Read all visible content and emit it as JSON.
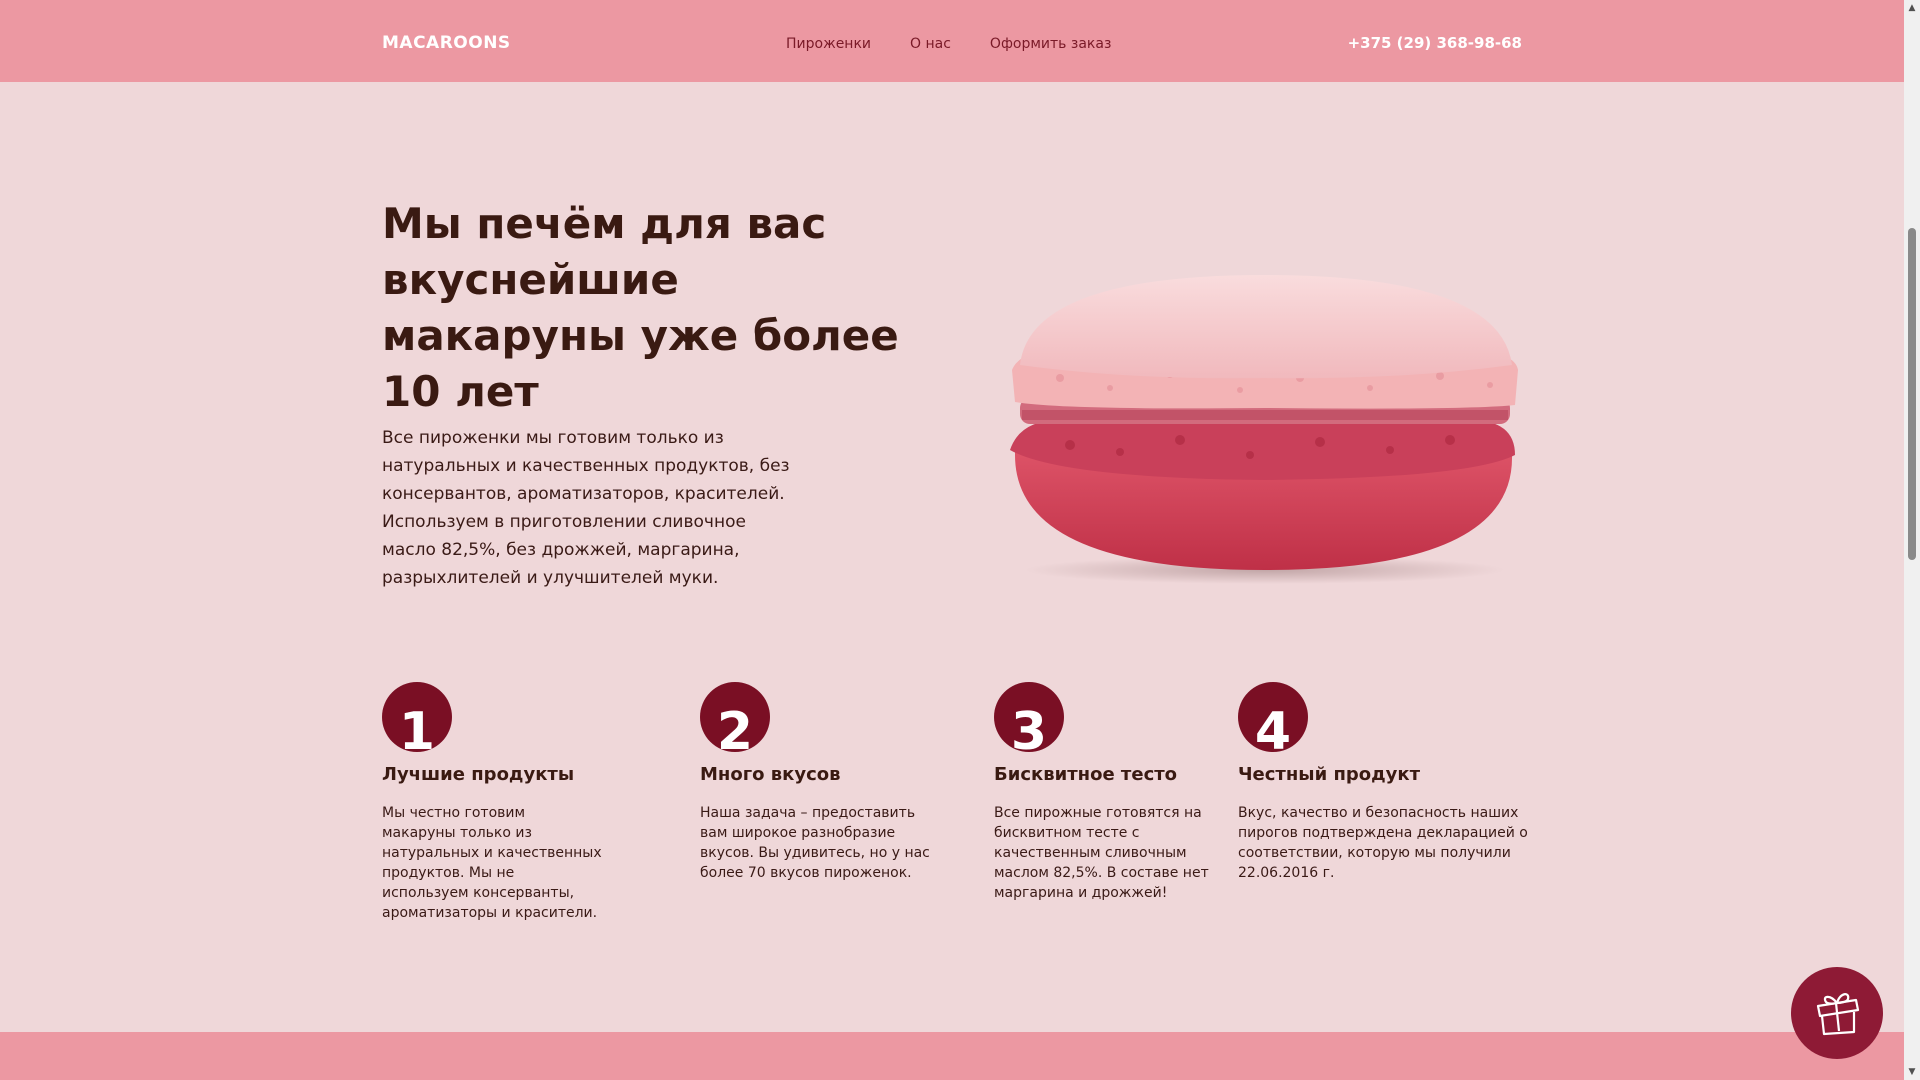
{
  "header": {
    "logo": "MACAROONS",
    "nav": [
      "Пироженки",
      "О нас",
      "Оформить заказ"
    ],
    "phone": "+375 (29) 368-98-68"
  },
  "hero": {
    "title": "Мы печём для вас вкуснейшие макаруны уже более 10 лет",
    "text": "Все пироженки мы готовим только из натуральных и качественных продуктов, без консервантов, ароматизаторов, красителей. Используем в приготовлении сливочное масло 82,5%, без дрожжей, маргарина, разрыхлителей и улучшителей муки."
  },
  "features": [
    {
      "number": "1",
      "title": "Лучшие продукты",
      "text": "Мы честно готовим макаруны только из натуральных и качественных продуктов. Мы не используем консерванты, ароматизаторы и красители."
    },
    {
      "number": "2",
      "title": "Много вкусов",
      "text": "Наша задача – предоставить вам широкое разнобразие вкусов. Вы удивитесь, но у нас более 70 вкусов пироженок."
    },
    {
      "number": "3",
      "title": "Бисквитное тесто",
      "text": "Все пирожные готовятся на бисквитном тесте с качественным сливочным маслом 82,5%. В составе нет маргарина и дрожжей!"
    },
    {
      "number": "4",
      "title": "Честный продукт",
      "text": "Вкус, качество и безопасность наших пирогов подтверждена декларацией о соответствии, которую мы получили 22.06.2016 г."
    }
  ],
  "icons": {
    "gift": "gift-icon",
    "scroll_up": "▲",
    "scroll_down": "▼"
  },
  "colors": {
    "header_bg": "#ec98a2",
    "page_bg": "#efd7d9",
    "accent": "#7a0f24",
    "gift_bg": "#8e1a35"
  }
}
